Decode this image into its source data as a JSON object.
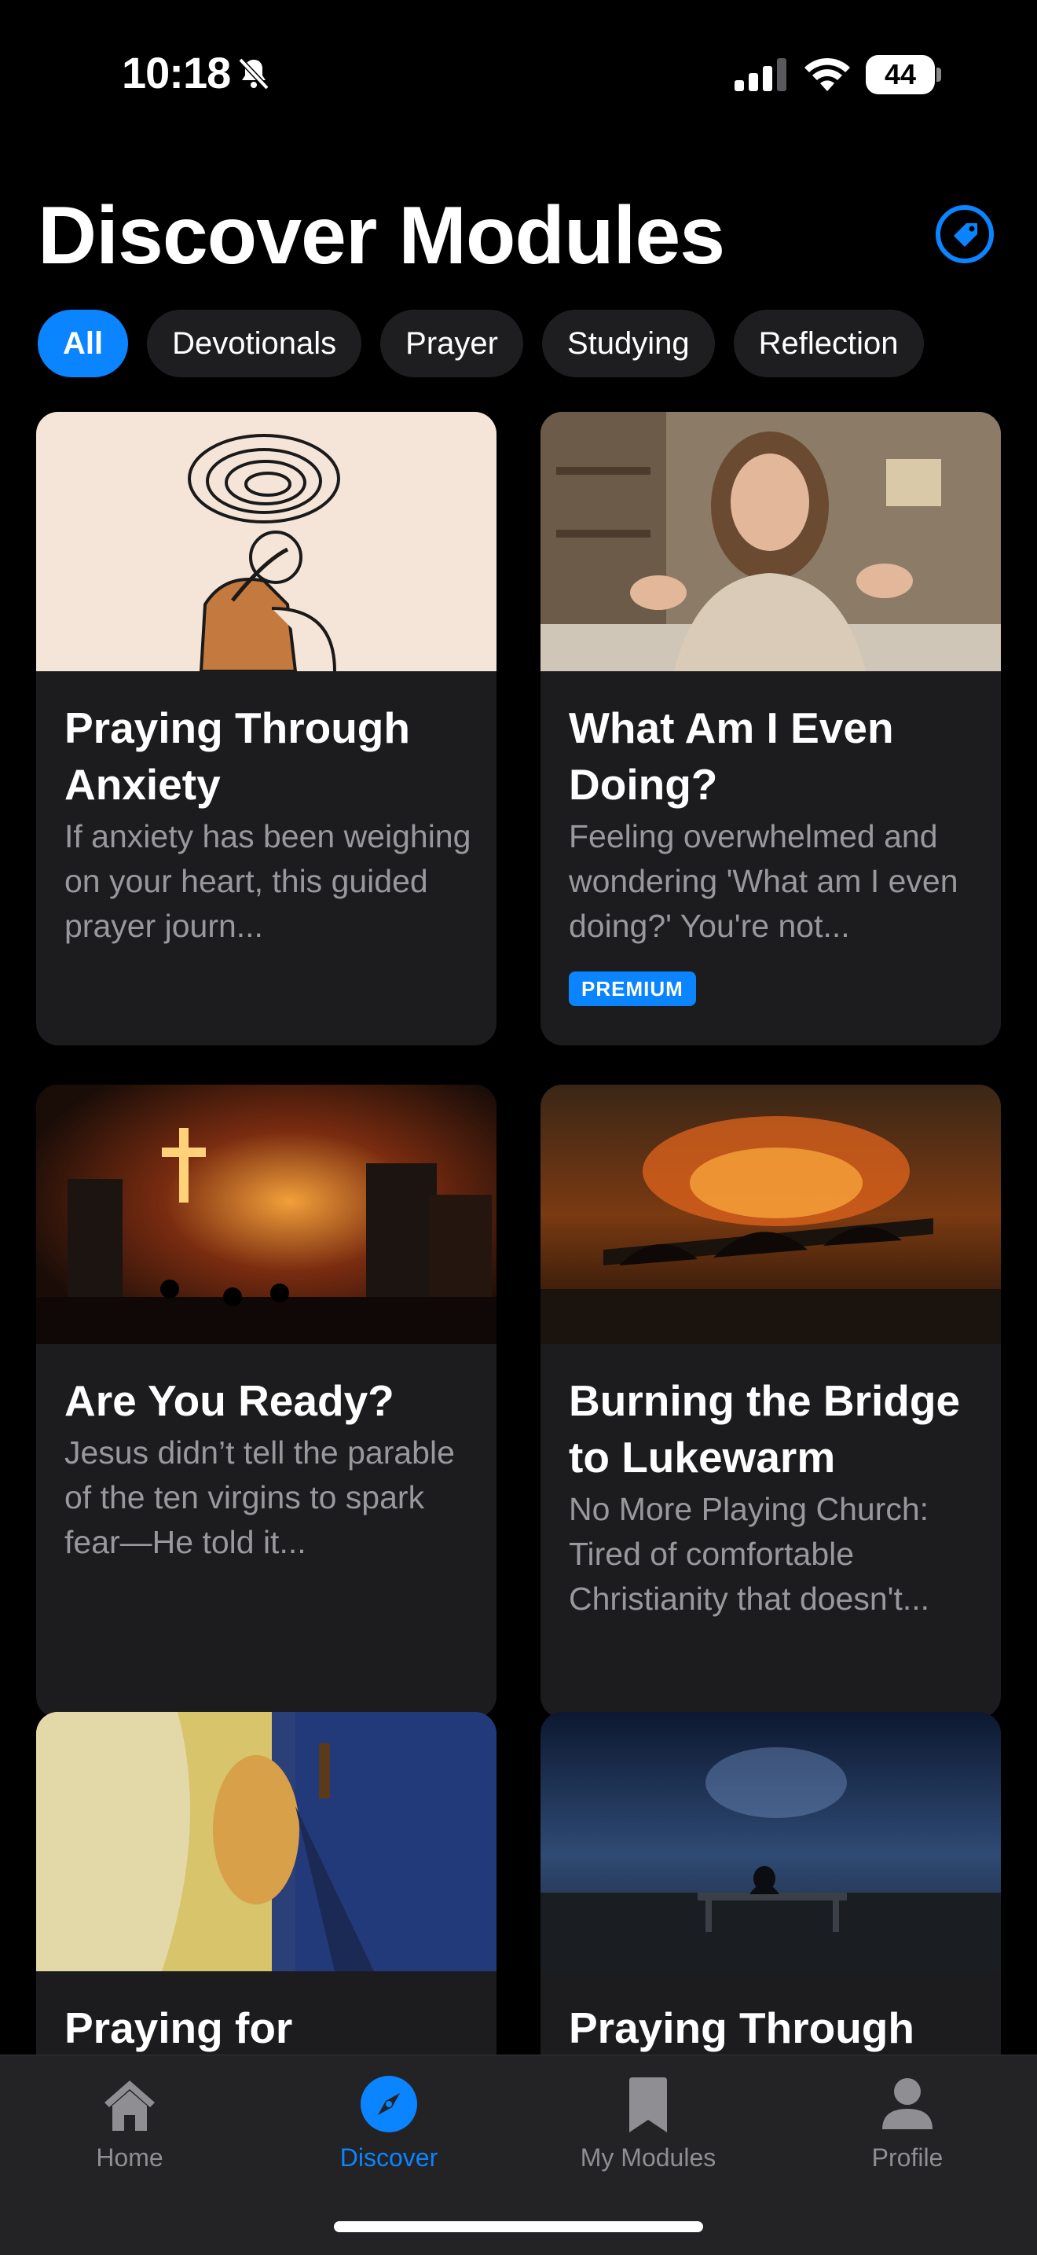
{
  "status_bar": {
    "time": "10:18",
    "battery": "44"
  },
  "header": {
    "title": "Discover Modules"
  },
  "filters": [
    {
      "label": "All",
      "active": true
    },
    {
      "label": "Devotionals",
      "active": false
    },
    {
      "label": "Prayer",
      "active": false
    },
    {
      "label": "Studying",
      "active": false
    },
    {
      "label": "Reflection",
      "active": false
    }
  ],
  "cards": [
    {
      "title": "Praying Through Anxiety",
      "description": "If anxiety has been weighing on your heart, this guided prayer journ...",
      "badge": ""
    },
    {
      "title": "What Am I Even Doing?",
      "description": "Feeling overwhelmed and wondering 'What am I even doing?' You're not...",
      "badge": "PREMIUM"
    },
    {
      "title": "Are You Ready?",
      "description": "Jesus didn’t tell the parable of the ten virgins to spark fear—He told it...",
      "badge": ""
    },
    {
      "title": "Burning the Bridge to Lukewarm",
      "description": "No More Playing Church: Tired of comfortable Christianity that doesn't...",
      "badge": ""
    },
    {
      "title": "Praying for",
      "description": "",
      "badge": ""
    },
    {
      "title": "Praying Through",
      "description": "",
      "badge": ""
    }
  ],
  "tab_bar": {
    "tabs": [
      {
        "label": "Home",
        "icon": "house-icon",
        "active": false
      },
      {
        "label": "Discover",
        "icon": "compass-icon",
        "active": true
      },
      {
        "label": "My Modules",
        "icon": "bookmark-icon",
        "active": false
      },
      {
        "label": "Profile",
        "icon": "person-icon",
        "active": false
      }
    ]
  },
  "colors": {
    "accent": "#0a84ff",
    "card_bg": "#1c1c1e",
    "background": "#000000"
  }
}
